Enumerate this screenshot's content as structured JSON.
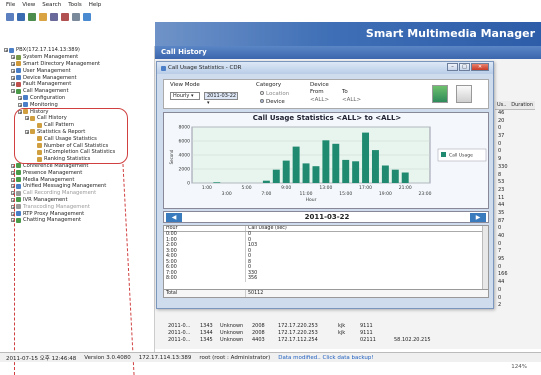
{
  "menu": [
    "File",
    "View",
    "Search",
    "Tools",
    "Help"
  ],
  "app_title": "Smart Multimedia Manager",
  "tree": [
    {
      "label": "PBX(172.17.114.13:389)",
      "depth": 0,
      "color": "#4a7fc8"
    },
    {
      "label": "System Management",
      "depth": 1,
      "color": "#7a9a4a"
    },
    {
      "label": "Smart Directory Management",
      "depth": 1,
      "color": "#d09a3a"
    },
    {
      "label": "User Management",
      "depth": 1,
      "color": "#4a7fc8"
    },
    {
      "label": "Device Management",
      "depth": 1,
      "color": "#4a7fc8"
    },
    {
      "label": "Fault Management",
      "depth": 1,
      "color": "#c0504d"
    },
    {
      "label": "Call Management",
      "depth": 1,
      "color": "#4a9a4a"
    },
    {
      "label": "Configuration",
      "depth": 2,
      "color": "#4a7fc8"
    },
    {
      "label": "Monitoring",
      "depth": 2,
      "color": "#4a7fc8"
    },
    {
      "label": "History",
      "depth": 2,
      "color": "#d0a040"
    },
    {
      "label": "Call History",
      "depth": 3,
      "color": "#d0a040"
    },
    {
      "label": "Call Pattern",
      "depth": 4,
      "color": "#d0a040"
    },
    {
      "label": "Statistics & Report",
      "depth": 3,
      "color": "#d0a040"
    },
    {
      "label": "Call Usage Statistics",
      "depth": 4,
      "color": "#d0a040"
    },
    {
      "label": "Number of Call Statistics",
      "depth": 4,
      "color": "#d0a040"
    },
    {
      "label": "InCompletion Call Statistics",
      "depth": 4,
      "color": "#d0a040"
    },
    {
      "label": "Ranking Statistics",
      "depth": 4,
      "color": "#d0a040"
    },
    {
      "label": "Conference Management",
      "depth": 1,
      "color": "#4a9a4a"
    },
    {
      "label": "Presence Management",
      "depth": 1,
      "color": "#4a9a4a"
    },
    {
      "label": "Media Management",
      "depth": 1,
      "color": "#4a9a4a"
    },
    {
      "label": "Unified Messaging Management",
      "depth": 1,
      "color": "#4a7fc8"
    },
    {
      "label": "Call Recording Management",
      "depth": 1,
      "color": "#999"
    },
    {
      "label": "IVR Management",
      "depth": 1,
      "color": "#4a9a4a"
    },
    {
      "label": "Transcoding Management",
      "depth": 1,
      "color": "#999"
    },
    {
      "label": "RTP Proxy Management",
      "depth": 1,
      "color": "#4a7fc8"
    },
    {
      "label": "Chatting Management",
      "depth": 1,
      "color": "#4a9a4a"
    }
  ],
  "panel_title": "Call History",
  "right_col": {
    "headers": [
      "Us..",
      "Duration"
    ],
    "values": [
      "46",
      "20",
      "0",
      "37",
      "0",
      "0",
      "9",
      "330",
      "8",
      "53",
      "23",
      "11",
      "44",
      "35",
      "87",
      "0",
      "40",
      "0",
      "7",
      "95",
      "0",
      "166",
      "44",
      "0",
      "0",
      "2"
    ]
  },
  "bg_rows": [
    {
      "date": "2011-0...",
      "id": "1343",
      "type": "Unknown",
      "num": "2008",
      "ip": "172.17.220.253",
      "user": "kjk",
      "dest": "9111",
      "ip2": ""
    },
    {
      "date": "2011-0...",
      "id": "1344",
      "type": "Unknown",
      "num": "2008",
      "ip": "172.17.220.253",
      "user": "kjk",
      "dest": "9111",
      "ip2": ""
    },
    {
      "date": "2011-0...",
      "id": "1345",
      "type": "Unknown",
      "num": "4403",
      "ip": "172.17.112.254",
      "user": "",
      "dest": "02111",
      "ip2": "58.102.20.215"
    }
  ],
  "dialog": {
    "title": "Call Usage Statistics - CDR",
    "view_mode_label": "View Mode",
    "view_mode_value": "Hourly",
    "date_value": "2011-03-22",
    "category_label": "Category",
    "category_options": [
      "Location",
      "Device"
    ],
    "category_selected": "Device",
    "device_label": "Device",
    "from_label": "From",
    "to_label": "To",
    "from_value": "<ALL>",
    "to_value": "<ALL>",
    "date_banner": "2011-03-22"
  },
  "chart_data": {
    "type": "bar",
    "title": "Call Usage Statistics <ALL> to <ALL>",
    "xlabel": "Hour",
    "ylabel": "Second",
    "ylim": [
      0,
      8000
    ],
    "y_ticks": [
      "0",
      "2000",
      "4000",
      "6000",
      "8000"
    ],
    "x_ticks_top": [
      "1:00",
      "5:00",
      "9:00",
      "13:00",
      "17:00",
      "21:00"
    ],
    "x_ticks_bottom": [
      "3:00",
      "7:00",
      "11:00",
      "15:00",
      "19:00",
      "23:00"
    ],
    "categories": [
      "0:00",
      "1:00",
      "2:00",
      "3:00",
      "4:00",
      "5:00",
      "6:00",
      "7:00",
      "8:00",
      "9:00",
      "10:00",
      "11:00",
      "12:00",
      "13:00",
      "14:00",
      "15:00",
      "16:00",
      "17:00",
      "18:00",
      "19:00",
      "20:00",
      "21:00",
      "22:00",
      "23:00"
    ],
    "series": [
      {
        "name": "Call Usage",
        "color": "#1f8a70",
        "values": [
          0,
          0,
          103,
          0,
          0,
          0,
          0,
          330,
          1900,
          3200,
          5200,
          2800,
          2400,
          6100,
          5600,
          3300,
          3100,
          7200,
          4700,
          2500,
          1900,
          1500,
          0,
          0
        ]
      }
    ]
  },
  "table": {
    "headers": [
      "Hour",
      "Call Usage (sec)"
    ],
    "rows": [
      [
        "0:00",
        "0"
      ],
      [
        "1:00",
        "0"
      ],
      [
        "2:00",
        "103"
      ],
      [
        "3:00",
        "0"
      ],
      [
        "4:00",
        "0"
      ],
      [
        "5:00",
        "8"
      ],
      [
        "6:00",
        "0"
      ],
      [
        "7:00",
        "330"
      ],
      [
        "8:00",
        "356"
      ]
    ],
    "total_label": "Total",
    "total_value": "50112"
  },
  "status": {
    "datetime": "2011-07-15 오후 12:46:48",
    "version": "Version 3.0.4080",
    "server": "172.17.114.13:389",
    "user": "root (root : Administrator)",
    "note": "Data modified.. Click data backup!",
    "zoom": "124%"
  }
}
